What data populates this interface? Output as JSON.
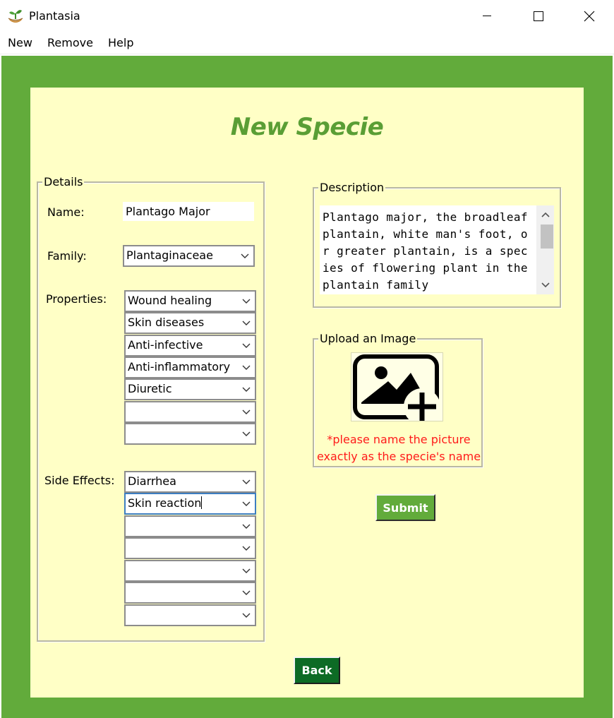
{
  "window": {
    "title": "Plantasia"
  },
  "menu": {
    "items": [
      "New",
      "Remove",
      "Help"
    ]
  },
  "form": {
    "heading": "New Specie",
    "details_legend": "Details",
    "name_label": "Name:",
    "name_value": "Plantago Major",
    "family_label": "Family:",
    "family_value": "Plantaginaceae",
    "properties_label": "Properties:",
    "properties": [
      "Wound healing",
      "Skin diseases",
      "Anti-infective",
      "Anti-inflammatory",
      "Diuretic",
      "",
      ""
    ],
    "side_effects_label": "Side Effects:",
    "side_effects": [
      "Diarrhea",
      "Skin reaction",
      "",
      "",
      "",
      "",
      ""
    ],
    "description_legend": "Description",
    "description": "Plantago major, the broadleaf plantain, white man's foot, or greater plantain, is a species of flowering plant in the plantain family",
    "upload_legend": "Upload an Image",
    "upload_note": "*please name the picture exactly as the specie's name",
    "submit_label": "Submit",
    "back_label": "Back"
  },
  "colors": {
    "frame_green": "#62ab3b",
    "panel_yellow": "#ffffc6",
    "heading_green": "#5a9e35",
    "note_red": "#ff1a1a",
    "back_green": "#0d6b25"
  },
  "icons": {
    "app": "plant-sprout-icon",
    "upload": "image-add-icon"
  }
}
